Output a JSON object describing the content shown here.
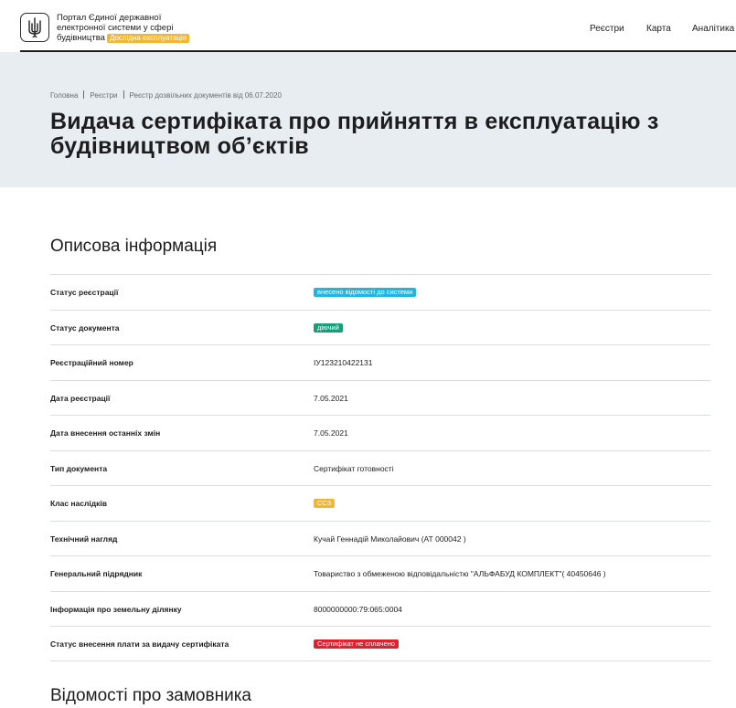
{
  "header": {
    "portal_line1": "Портал Єдиної державної",
    "portal_line2": "електронної системи у сфері",
    "portal_line3": "будівництва",
    "beta_label": "Дослідна експлуатація",
    "beta_color": "#f2b632",
    "logo_icon": "trident-icon",
    "nav": {
      "registers": "Реєстри",
      "map": "Карта",
      "analytics": "Аналітика"
    }
  },
  "breadcrumb": {
    "home": "Головна",
    "registers": "Реєстри",
    "current": "Реєстр дозвільних документів від 06.07.2020"
  },
  "page": {
    "title_line1": "Видача сертифіката про прийняття в експлуатацію з",
    "title_line2": "будівництвом об’єктів"
  },
  "sections": {
    "description": "Описова інформація",
    "customer": "Відомості про замовника"
  },
  "info_rows": [
    {
      "label": "Статус реєстрації",
      "value": "внесено відомості до системи",
      "badge_color": "#1fb6e0"
    },
    {
      "label": "Статус документа",
      "value": "діючий",
      "badge_color": "#1a9e7a"
    },
    {
      "label": "Реєстраційний номер",
      "value": "ІУ123210422131"
    },
    {
      "label": "Дата реєстрації",
      "value": "7.05.2021"
    },
    {
      "label": "Дата внесення останніх змін",
      "value": "7.05.2021"
    },
    {
      "label": "Тип документа",
      "value": "Сертифікат готовності"
    },
    {
      "label": "Клас наслідків",
      "value": "СС3",
      "badge_color": "#f2b632"
    },
    {
      "label": "Технічний нагляд",
      "value": "Кучай Геннадій Миколайович (АТ 000042 )"
    },
    {
      "label": "Генеральний підрядник",
      "value": "Товариство з обмеженою відповідальністю \"АЛЬФАБУД КОМПЛЕКТ\"( 40450646 )"
    },
    {
      "label": "Інформація про земельну ділянку",
      "value": "8000000000:79:065:0004"
    },
    {
      "label": "Статус внесення плати за видачу сертифіката",
      "value": "Сертифікат не сплачено",
      "badge_color": "#e0202e"
    }
  ],
  "colors": {
    "hero_bg": "#e8edf2",
    "text": "#1d1d1d",
    "divider": "#d9dde2"
  }
}
